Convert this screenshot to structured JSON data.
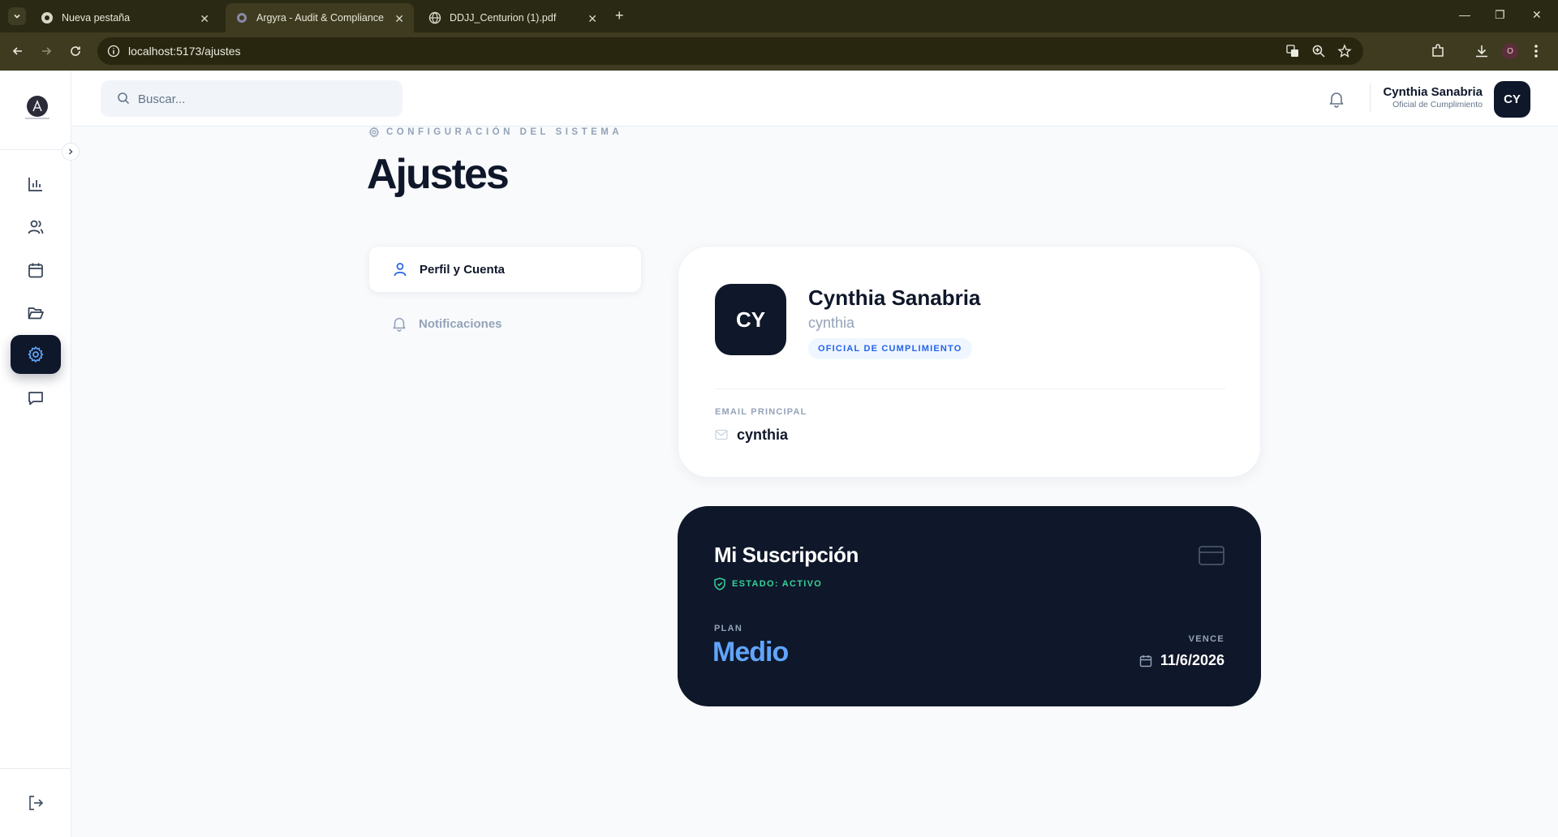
{
  "browser": {
    "tabs": [
      {
        "title": "Nueva pestaña",
        "active": false
      },
      {
        "title": "Argyra - Audit & Compliance",
        "active": true
      },
      {
        "title": "DDJJ_Centurion (1).pdf",
        "active": false
      }
    ],
    "url": "localhost:5173/ajustes",
    "profile_initial": "O"
  },
  "header": {
    "search_placeholder": "Buscar...",
    "user_name": "Cynthia Sanabria",
    "user_role": "Oficial de Cumplimiento",
    "user_initials": "CY"
  },
  "sidebar": {
    "items": [
      {
        "name": "reports",
        "icon": "bar-chart-icon",
        "active": false
      },
      {
        "name": "users",
        "icon": "users-icon",
        "active": false
      },
      {
        "name": "calendar",
        "icon": "calendar-icon",
        "active": false
      },
      {
        "name": "folders",
        "icon": "folder-open-icon",
        "active": false
      },
      {
        "name": "settings",
        "icon": "gear-icon",
        "active": true
      },
      {
        "name": "messages",
        "icon": "message-icon",
        "active": false
      }
    ],
    "logout_icon": "logout-icon"
  },
  "page": {
    "eyebrow": "Configuración del sistema",
    "title": "Ajustes"
  },
  "settings_nav": [
    {
      "label": "Perfil y Cuenta",
      "icon": "user-icon",
      "active": true
    },
    {
      "label": "Notificaciones",
      "icon": "bell-icon",
      "active": false
    }
  ],
  "profile": {
    "initials": "CY",
    "name": "Cynthia Sanabria",
    "username": "cynthia",
    "role_badge": "Oficial de Cumplimiento",
    "email_label": "Email Principal",
    "email": "cynthia"
  },
  "subscription": {
    "title": "Mi Suscripción",
    "status": "Estado: Activo",
    "plan_label": "Plan",
    "plan": "Medio",
    "expires_label": "Vence",
    "expires": "11/6/2026"
  },
  "colors": {
    "primary_dark": "#0f172a",
    "accent_blue": "#60a5fa",
    "status_green": "#34d399",
    "badge_blue": "#2563eb"
  }
}
